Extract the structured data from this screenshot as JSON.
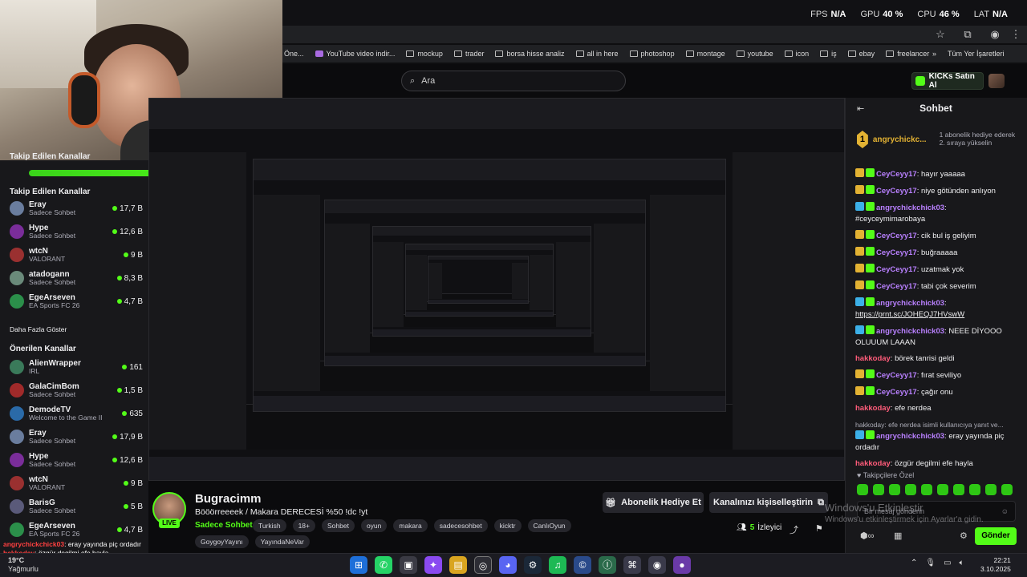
{
  "stats": {
    "fps_label": "FPS",
    "fps": "N/A",
    "gpu_label": "GPU",
    "gpu": "40 %",
    "cpu_label": "CPU",
    "cpu": "46 %",
    "lat_label": "LAT",
    "lat": "N/A"
  },
  "bookmarks": [
    "Öne...",
    "YouTube video indir...",
    "mockup",
    "trader",
    "borsa hisse analiz",
    "all in here",
    "photoshop",
    "montage",
    "youtube",
    "icon",
    "iş",
    "ebay",
    "freelancer"
  ],
  "bookmarks_more": "»",
  "bookmarks_all": "Tüm Yer İşaretleri",
  "search": {
    "placeholder": "Ara"
  },
  "kicks_button": "KICKs Satın Al",
  "sidebar": {
    "header_partial": "Takip Edilen Kanallar",
    "pbar_label": "100",
    "pbar_value": 0.98,
    "following_title": "Takip Edilen Kanallar",
    "following": [
      {
        "name": "Eray",
        "category": "Sadece Sohbet",
        "count": "17,7 B",
        "color": "#6a7d9e"
      },
      {
        "name": "Hype",
        "category": "Sadece Sohbet",
        "count": "12,6 B",
        "color": "#7a2d9a"
      },
      {
        "name": "wtcN",
        "category": "VALORANT",
        "count": "9 B",
        "color": "#9a3030"
      },
      {
        "name": "atadogann",
        "category": "Sadece Sohbet",
        "count": "8,3 B",
        "color": "#6a8a7a"
      },
      {
        "name": "EgeArseven",
        "category": "EA Sports FC 26",
        "count": "4,7 B",
        "color": "#2b8f4a"
      }
    ],
    "show_more": "Daha Fazla Göster",
    "recommended_title": "Önerilen Kanallar",
    "recommended": [
      {
        "name": "AlienWrapper",
        "category": "IRL",
        "count": "161",
        "color": "#3a7a5a"
      },
      {
        "name": "GalaCimBom",
        "category": "Sadece Sohbet",
        "count": "1,5 B",
        "color": "#a02a2a"
      },
      {
        "name": "DemodeTV",
        "category": "Welcome to the Game II",
        "count": "635",
        "color": "#2a6aa8"
      },
      {
        "name": "Eray",
        "category": "Sadece Sohbet",
        "count": "17,9 B",
        "color": "#6a7d9e"
      },
      {
        "name": "Hype",
        "category": "Sadece Sohbet",
        "count": "12,6 B",
        "color": "#7a2d9a"
      },
      {
        "name": "wtcN",
        "category": "VALORANT",
        "count": "9 B",
        "color": "#9a3030"
      },
      {
        "name": "BarisG",
        "category": "Sadece Sohbet",
        "count": "5 B",
        "color": "#5a5a7a"
      },
      {
        "name": "EgeArseven",
        "category": "EA Sports FC 26",
        "count": "4,7 B",
        "color": "#2b8f4a"
      }
    ]
  },
  "stream": {
    "streamer": "Bugracimm",
    "live": "LIVE",
    "title": "Bööörreeeek  / Makara DERECESİ %50 !dc !yt",
    "category": "Sadece Sohbet",
    "tags": [
      "Turkish",
      "18+",
      "Sohbet",
      "oyun",
      "makara",
      "sadecesohbet",
      "kicktr",
      "CanlıOyun"
    ],
    "tags2": [
      "GoygoyYayını",
      "YayındaNeVar"
    ],
    "gift_button": "Abonelik Hediye Et",
    "customize_button": "Kanalınızı kişiselleştirin",
    "viewers_count": "5",
    "viewers_label": "İzleyici"
  },
  "chat": {
    "title": "Sohbet",
    "pinned_user": "angrychickc...",
    "pinned_rank": "1",
    "pinned_desc": "1 abonelik hediye ederek 2. sıraya yükselin",
    "messages": [
      {
        "user": "CeyCeyy17",
        "cls": "u-purple",
        "badges": [
          "bd-crown",
          "bd-sub"
        ],
        "text": "hayır yaaaaa"
      },
      {
        "user": "CeyCeyy17",
        "cls": "u-purple",
        "badges": [
          "bd-crown",
          "bd-sub"
        ],
        "text": "niye götünden anlıyon"
      },
      {
        "user": "angrychickchick03",
        "cls": "u-purple",
        "badges": [
          "bd-blue",
          "bd-sub"
        ],
        "text": "#ceyceymimarobaya"
      },
      {
        "user": "CeyCeyy17",
        "cls": "u-purple",
        "badges": [
          "bd-crown",
          "bd-sub"
        ],
        "text": "cik bul iş geliyim"
      },
      {
        "user": "CeyCeyy17",
        "cls": "u-purple",
        "badges": [
          "bd-crown",
          "bd-sub"
        ],
        "text": "buğraaaaa"
      },
      {
        "user": "CeyCeyy17",
        "cls": "u-purple",
        "badges": [
          "bd-crown",
          "bd-sub"
        ],
        "text": "uzatmak yok"
      },
      {
        "user": "CeyCeyy17",
        "cls": "u-purple",
        "badges": [
          "bd-crown",
          "bd-sub"
        ],
        "text": "tabi çok severim"
      },
      {
        "user": "angrychickchick03",
        "cls": "u-purple",
        "badges": [
          "bd-blue",
          "bd-sub"
        ],
        "text": "https://prnt.sc/JOHEQJ7HVswW"
      },
      {
        "user": "angrychickchick03",
        "cls": "u-purple",
        "badges": [
          "bd-blue",
          "bd-sub"
        ],
        "text": "NEEE DİYOOO OLUUUM LAAAN"
      },
      {
        "user": "hakkoday",
        "cls": "u-pink",
        "badges": [],
        "text": "börek tanrisi geldi"
      },
      {
        "user": "CeyCeyy17",
        "cls": "u-purple",
        "badges": [
          "bd-crown",
          "bd-sub"
        ],
        "text": "fırat seviliyo"
      },
      {
        "user": "CeyCeyy17",
        "cls": "u-purple",
        "badges": [
          "bd-crown",
          "bd-sub"
        ],
        "text": "çağır onu"
      },
      {
        "user": "hakkoday",
        "cls": "u-pink",
        "badges": [],
        "text": "efe nerdea"
      },
      {
        "reply": "hakkoday: efe nerdea isimli kullanıcıya yanıt ve...",
        "user": "angrychickchick03",
        "cls": "u-purple",
        "badges": [
          "bd-blue",
          "bd-sub"
        ],
        "text": "eray yayında piç ordadır"
      },
      {
        "user": "hakkoday",
        "cls": "u-pink",
        "badges": [],
        "text": "özgür degilmi efe hayla"
      }
    ],
    "special": "Takipçilere Özel",
    "input_placeholder": "Bir mesaj gönderin",
    "send": "Gönder"
  },
  "watermark": {
    "title": "Windows'u Etkinleştir",
    "desc": "Windows'u etkinleştirmek için Ayarlar'a gidin."
  },
  "overlay_chat": {
    "line1_user": "angrychickchick03",
    "line1_text": "eray yayında piç ordadır",
    "line2_user": "hakkoday",
    "line2_text": "özgür degilmi efe hayla"
  },
  "weather": {
    "temp": "19°C",
    "desc": "Yağmurlu"
  },
  "clock": {
    "time": "22:21",
    "date": "3.10.2025"
  },
  "colors": {
    "accent": "#53fc18",
    "bg": "#0e0e10",
    "panel": "#18181b"
  }
}
